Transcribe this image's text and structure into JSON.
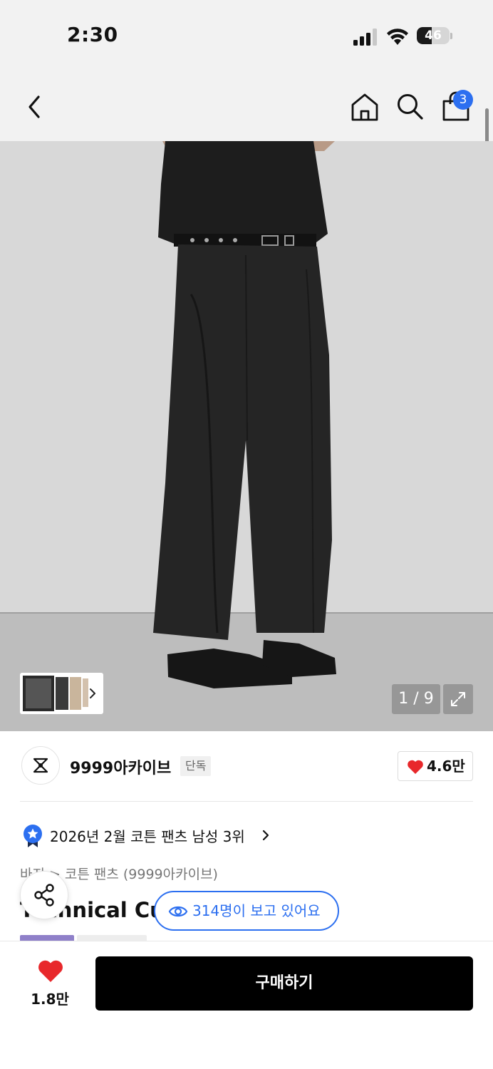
{
  "status_bar": {
    "time": "2:30",
    "battery_level": "46",
    "battery_fraction": 0.46,
    "icons": [
      "cellular-signal-icon",
      "wifi-icon",
      "battery-icon"
    ]
  },
  "nav": {
    "icons": [
      "back-icon",
      "home-icon",
      "search-icon",
      "shopping-bag-icon"
    ],
    "cart_count": "3",
    "accent_color": "#2c6ff0"
  },
  "gallery": {
    "counter": "1 / 9",
    "icons": [
      "chevron-right-icon",
      "expand-icon"
    ]
  },
  "brand": {
    "name": "9999아카이브",
    "tag": "단독",
    "likes": "4.6만",
    "like_color": "#e8282b"
  },
  "ranking": {
    "text": "2026년 2월 코튼 팬츠 남성 3위"
  },
  "breadcrumb": {
    "items": [
      "바지",
      ">",
      "코튼 팬츠",
      "(9999아카이브)"
    ]
  },
  "product": {
    "title": "Technical Cu"
  },
  "viewers": {
    "text": "314명이 보고 있어요"
  },
  "bottom_bar": {
    "like_count": "1.8만",
    "buy_label": "구매하기"
  }
}
